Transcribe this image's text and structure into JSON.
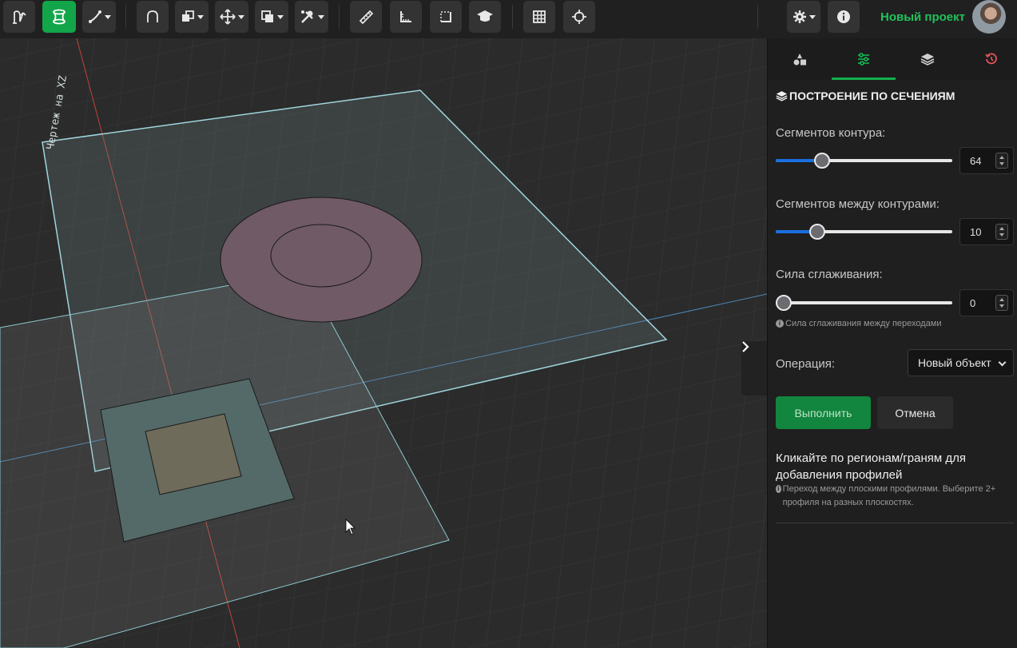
{
  "toolbar": {
    "project_name": "Новый проект",
    "buttons": [
      "sketch-tool",
      "loft-tool",
      "curve-tool",
      "arch-tool",
      "extrude-tool",
      "move-tool",
      "boolean-tool",
      "tools-menu",
      "measure-tool",
      "angle-tool",
      "bounds-tool",
      "tutorial",
      "grid-toggle",
      "target-tool",
      "settings",
      "info"
    ]
  },
  "viewport": {
    "sketch_label": "Чертеж на XZ"
  },
  "panel": {
    "tabs": [
      "shapes",
      "parameters",
      "layers",
      "history"
    ],
    "active_tab": "parameters",
    "section_title": "ПОСТРОЕНИЕ ПО СЕЧЕНИЯМ",
    "contour_segments_label": "Сегментов контура:",
    "contour_segments_value": "64",
    "contour_segments_fraction": 0.26,
    "between_segments_label": "Сегментов между контурами:",
    "between_segments_value": "10",
    "between_segments_fraction": 0.23,
    "smoothing_label": "Сила сглаживания:",
    "smoothing_value": "0",
    "smoothing_fraction": 0.0,
    "smoothing_hint": "Сила сглаживания между переходами",
    "operation_label": "Операция:",
    "operation_value": "Новый объект",
    "execute_label": "Выполнить",
    "cancel_label": "Отмена",
    "instruction_title": "Кликайте по регионам/граням для добавления профилей",
    "instruction_hint": "Переход между плоскими профилями. Выберите 2+ профиля на разных плоскостях."
  },
  "colors": {
    "accent": "#12a54a",
    "project_name": "#21c25a",
    "slider_fill": "#1a6fe0"
  }
}
